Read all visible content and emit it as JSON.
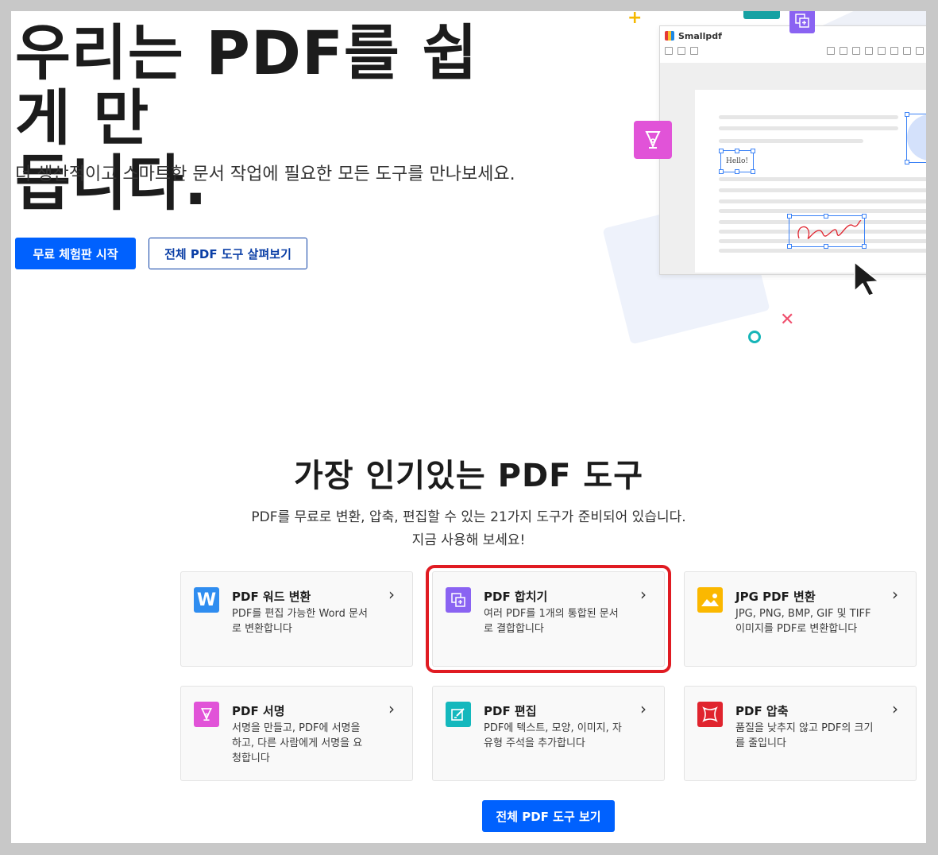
{
  "hero": {
    "title_line1": "우리는 PDF를 쉽게 만",
    "title_line2": "듭니다.",
    "subtitle": "더 생산적이고 스마트한 문서 작업에 필요한 모든 도구를 만나보세요.",
    "primary_button": "무료 체험판 시작",
    "secondary_button": "전체 PDF 도구 살펴보기"
  },
  "illustration": {
    "app_name": "Smallpdf",
    "hello_text": "Hello!"
  },
  "tools_section": {
    "title": "가장 인기있는 PDF 도구",
    "subtitle_line1": "PDF를 무료로 변환, 압축, 편집할 수 있는 21가지 도구가 준비되어 있습니다.",
    "subtitle_line2": "지금 사용해 보세요!",
    "cta_button": "전체 PDF 도구 보기",
    "tools": [
      {
        "name": "PDF 워드 변환",
        "desc": "PDF를 편집 가능한 Word 문서로 변환합니다",
        "icon": "word-icon",
        "color": "#2f8df0"
      },
      {
        "name": "PDF 합치기",
        "desc": "여러 PDF를 1개의 통합된 문서로 결합합니다",
        "icon": "merge-icon",
        "color": "#8a63f2"
      },
      {
        "name": "JPG PDF 변환",
        "desc": "JPG, PNG, BMP, GIF 및 TIFF 이미지를 PDF로 변환합니다",
        "icon": "image-icon",
        "color": "#fbb800"
      },
      {
        "name": "PDF 서명",
        "desc": "서명을 만들고, PDF에 서명을 하고, 다른 사람에게 서명을 요청합니다",
        "icon": "pen-nib-icon",
        "color": "#e153d8"
      },
      {
        "name": "PDF 편집",
        "desc": "PDF에 텍스트, 모양, 이미지, 자유형 주석을 추가합니다",
        "icon": "edit-icon",
        "color": "#14b8bd"
      },
      {
        "name": "PDF 압축",
        "desc": "품질을 낮추지 않고 PDF의 크기를 줄입니다",
        "icon": "compress-icon",
        "color": "#e0242e"
      }
    ],
    "chevron": "›"
  },
  "colors": {
    "primary": "#0061fe",
    "highlight": "#e01b22"
  }
}
